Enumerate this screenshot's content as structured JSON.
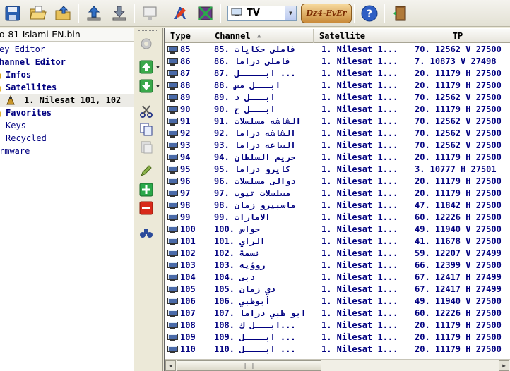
{
  "toolbar": {
    "items": [
      "save-icon",
      "open-folder-icon",
      "folder-upload-icon",
      "upload-icon",
      "download-icon",
      "monitor-icon",
      "text-editor-icon",
      "image-icon"
    ],
    "mode_value": "TV",
    "logo_text": "Dz4-EvEr",
    "help_label": "?",
    "exit_label": "exit"
  },
  "tree": {
    "file_name": "po-81-Islami-EN.bin",
    "items": {
      "key_editor": "ey Editor",
      "channel_editor": "hannel Editor",
      "infos": "Infos",
      "satellites": "Satellites",
      "nilesat": "1. Nilesat 101, 102",
      "favorites": "Favorites",
      "keys": "Keys",
      "recycled": "Recycled",
      "firmware": "rmware"
    }
  },
  "grid": {
    "columns": [
      "Type",
      "Channel",
      "Satellite",
      "TP"
    ],
    "rows": [
      {
        "type": "85",
        "channel": "85. فاملى حكايات",
        "satellite": "1. Nilesat 1...",
        "tp": "70. 12562 V 27500"
      },
      {
        "type": "86",
        "channel": "86. فاملى دراما",
        "satellite": "1. Nilesat 1...",
        "tp": "7. 10873 V 27498"
      },
      {
        "type": "87",
        "channel": "87. ابـــــل ...",
        "satellite": "1. Nilesat 1...",
        "tp": "20. 11179 H 27500"
      },
      {
        "type": "88",
        "channel": "88. ابـــل مس",
        "satellite": "1. Nilesat 1...",
        "tp": "20. 11179 H 27500"
      },
      {
        "type": "89",
        "channel": "89. ابـــل د",
        "satellite": "1. Nilesat 1...",
        "tp": "70. 12562 V 27500"
      },
      {
        "type": "90",
        "channel": "90. ابـــل ح",
        "satellite": "1. Nilesat 1...",
        "tp": "20. 11179 H 27500"
      },
      {
        "type": "91",
        "channel": "91. الشاشه مسلسلات",
        "satellite": "1. Nilesat 1...",
        "tp": "70. 12562 V 27500"
      },
      {
        "type": "92",
        "channel": "92. الشاشه دراما",
        "satellite": "1. Nilesat 1...",
        "tp": "70. 12562 V 27500"
      },
      {
        "type": "93",
        "channel": "93. الساعه دراما",
        "satellite": "1. Nilesat 1...",
        "tp": "70. 12562 V 27500"
      },
      {
        "type": "94",
        "channel": "94. حريم السلطان",
        "satellite": "1. Nilesat 1...",
        "tp": "20. 11179 H 27500"
      },
      {
        "type": "95",
        "channel": "95. كايرو دراما",
        "satellite": "1. Nilesat 1...",
        "tp": "3. 10777 H 27501"
      },
      {
        "type": "96",
        "channel": "96. دوالى مسلسلات",
        "satellite": "1. Nilesat 1...",
        "tp": "20. 11179 H 27500"
      },
      {
        "type": "97",
        "channel": "97. مسلسلات تيوب",
        "satellite": "1. Nilesat 1...",
        "tp": "20. 11179 H 27500"
      },
      {
        "type": "98",
        "channel": "98. ماسبيرو زمان",
        "satellite": "1. Nilesat 1...",
        "tp": "47. 11842 H 27500"
      },
      {
        "type": "99",
        "channel": "99. الامارات",
        "satellite": "1. Nilesat 1...",
        "tp": "60. 12226 H 27500"
      },
      {
        "type": "100",
        "channel": "100. حواس",
        "satellite": "1. Nilesat 1...",
        "tp": "49. 11940 V 27500"
      },
      {
        "type": "101",
        "channel": "101. الراي",
        "satellite": "1. Nilesat 1...",
        "tp": "41. 11678 V 27500"
      },
      {
        "type": "102",
        "channel": "102. نسمة",
        "satellite": "1. Nilesat 1...",
        "tp": "59. 12207 V 27499"
      },
      {
        "type": "103",
        "channel": "103. روؤيه",
        "satellite": "1. Nilesat 1...",
        "tp": "66. 12399 V 27500"
      },
      {
        "type": "104",
        "channel": "104. دبى",
        "satellite": "1. Nilesat 1...",
        "tp": "67. 12417 H 27499"
      },
      {
        "type": "105",
        "channel": "105. دي زمان",
        "satellite": "1. Nilesat 1...",
        "tp": "67. 12417 H 27499"
      },
      {
        "type": "106",
        "channel": "106. أبوظبي",
        "satellite": "1. Nilesat 1...",
        "tp": "49. 11940 V 27500"
      },
      {
        "type": "107",
        "channel": "107. ابو ظبي دراما",
        "satellite": "1. Nilesat 1...",
        "tp": "60. 12226 H 27500"
      },
      {
        "type": "108",
        "channel": "108. ابـــل ك...",
        "satellite": "1. Nilesat 1...",
        "tp": "20. 11179 H 27500"
      },
      {
        "type": "109",
        "channel": "109. ابــــل ...",
        "satellite": "1. Nilesat 1...",
        "tp": "20. 11179 H 27500"
      },
      {
        "type": "110",
        "channel": "110. ابــــل ...",
        "satellite": "1. Nilesat 1...",
        "tp": "20. 11179 H 27500"
      }
    ]
  },
  "colors": {
    "row_text": "#000080",
    "tree_bold": "#000080",
    "background": "#ece9d8"
  }
}
